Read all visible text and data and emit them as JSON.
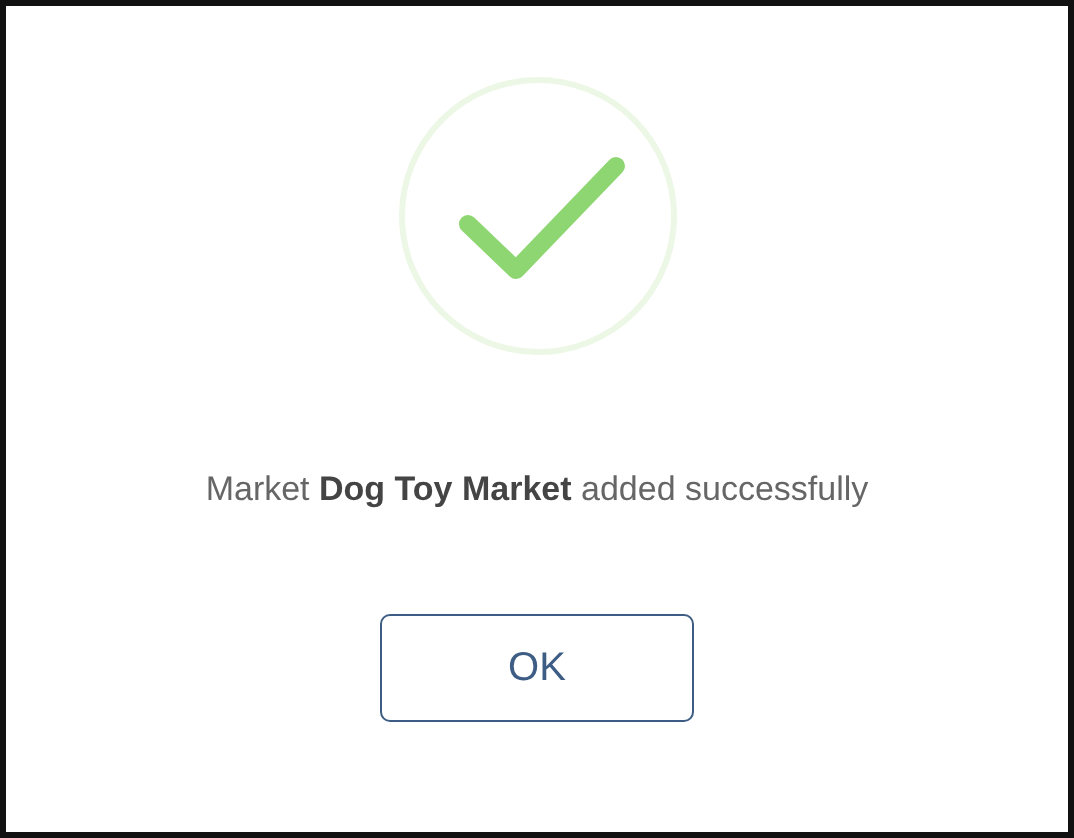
{
  "dialog": {
    "message": "Market **Dog Toy Market** added successfully",
    "buttons": [
      "OK"
    ]
  }
}
